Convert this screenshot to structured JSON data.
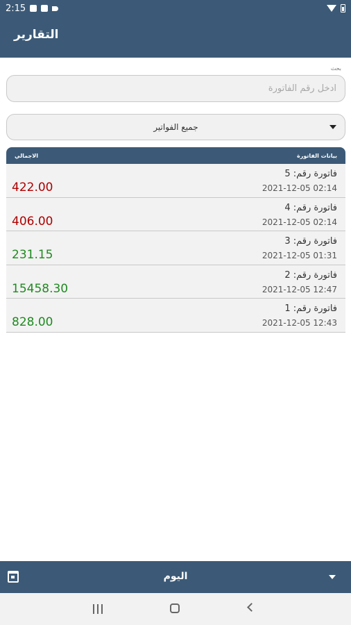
{
  "status_bar": {
    "time": "2:15"
  },
  "header": {
    "title": "التقارير"
  },
  "search": {
    "label": "بحث",
    "placeholder": "ادخل رقم الفاتورة",
    "value": ""
  },
  "filter": {
    "selected": "جميع الفواتير"
  },
  "table": {
    "columns": {
      "details": "بيانات الفاتورة",
      "total": "الاجمالي"
    },
    "rows": [
      {
        "title": "فاتورة رقم: 5",
        "date": "2021-12-05 02:14",
        "amount": "422.00",
        "status": "red"
      },
      {
        "title": "فاتورة رقم: 4",
        "date": "2021-12-05 02:14",
        "amount": "406.00",
        "status": "red"
      },
      {
        "title": "فاتورة رقم: 3",
        "date": "2021-12-05 01:31",
        "amount": "231.15",
        "status": "green"
      },
      {
        "title": "فاتورة رقم: 2",
        "date": "2021-12-05 12:47",
        "amount": "15458.30",
        "status": "green"
      },
      {
        "title": "فاتورة رقم: 1",
        "date": "2021-12-05 12:43",
        "amount": "828.00",
        "status": "green"
      }
    ]
  },
  "bottom_bar": {
    "period": "اليوم"
  },
  "colors": {
    "primary": "#3c5a77",
    "red": "#b00000",
    "green": "#1f8a1f"
  },
  "icons": [
    "image-icon",
    "save-icon",
    "send-icon",
    "wifi-icon",
    "battery-icon",
    "dropdown-caret-icon",
    "calendar-icon",
    "recent-apps-icon",
    "home-icon",
    "back-icon"
  ]
}
